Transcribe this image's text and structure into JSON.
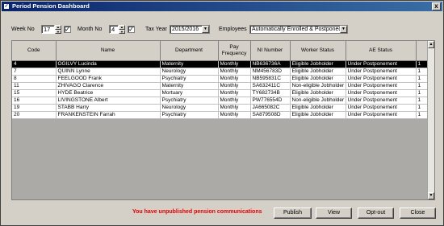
{
  "window": {
    "title": "Period Pension Dashboard",
    "close_glyph": "x"
  },
  "filters": {
    "week_label": "Week No",
    "week_value": "17",
    "week_checked": "✓",
    "month_label": "Month No",
    "month_value": "4",
    "month_checked": "✓",
    "tax_year_label": "Tax Year",
    "tax_year_value": "2015/2016",
    "employees_label": "Employees",
    "employees_value": "Automatically Enrolled & Postponed"
  },
  "table": {
    "columns": [
      "Code",
      "Name",
      "Department",
      "Pay Frequency",
      "NI Number",
      "Worker Status",
      "AE Status",
      ""
    ],
    "rows": [
      [
        "4",
        "OGILVY Lucinda",
        "Maternity",
        "Monthly",
        "NB636736A",
        "Eligible Jobholder",
        "Under Postponement",
        "1"
      ],
      [
        "7",
        "QUINN Lynne",
        "Neurology",
        "Monthly",
        "NM456783D",
        "Eligible Jobholder",
        "Under Postponement",
        "1"
      ],
      [
        "8",
        "FEELGOOD Frank",
        "Psychiatry",
        "Monthly",
        "NB595831C",
        "Eligible Jobholder",
        "Under Postponement",
        "1"
      ],
      [
        "11",
        "ZHIVAGO Clarence",
        "Maternity",
        "Monthly",
        "SA632411C",
        "Non-eligible Jobholder",
        "Under Postponement",
        "1"
      ],
      [
        "15",
        "HYDE Beatrice",
        "Mortuary",
        "Monthly",
        "TY682734B",
        "Eligible Jobholder",
        "Under Postponement",
        "1"
      ],
      [
        "16",
        "LIVINGSTONE Albert",
        "Psychiatry",
        "Monthly",
        "PW776554D",
        "Non-eligible Jobholder",
        "Under Postponement",
        "1"
      ],
      [
        "19",
        "STABB Harry",
        "Neurology",
        "Monthly",
        "JA665082C",
        "Eligible Jobholder",
        "Under Postponement",
        "1"
      ],
      [
        "20",
        "FRANKENSTEIN Farrah",
        "Psychiatry",
        "Monthly",
        "SA879508D",
        "Eligible Jobholder",
        "Under Postponement",
        "1"
      ]
    ],
    "selected_row": 0
  },
  "footer": {
    "warning": "You have unpublished pension communications",
    "publish": "Publish",
    "view": "View",
    "optout": "Opt-out",
    "close": "Close"
  },
  "colors": {
    "warning": "#e00000",
    "title_start": "#0a246a",
    "title_end": "#3a6ea5"
  }
}
